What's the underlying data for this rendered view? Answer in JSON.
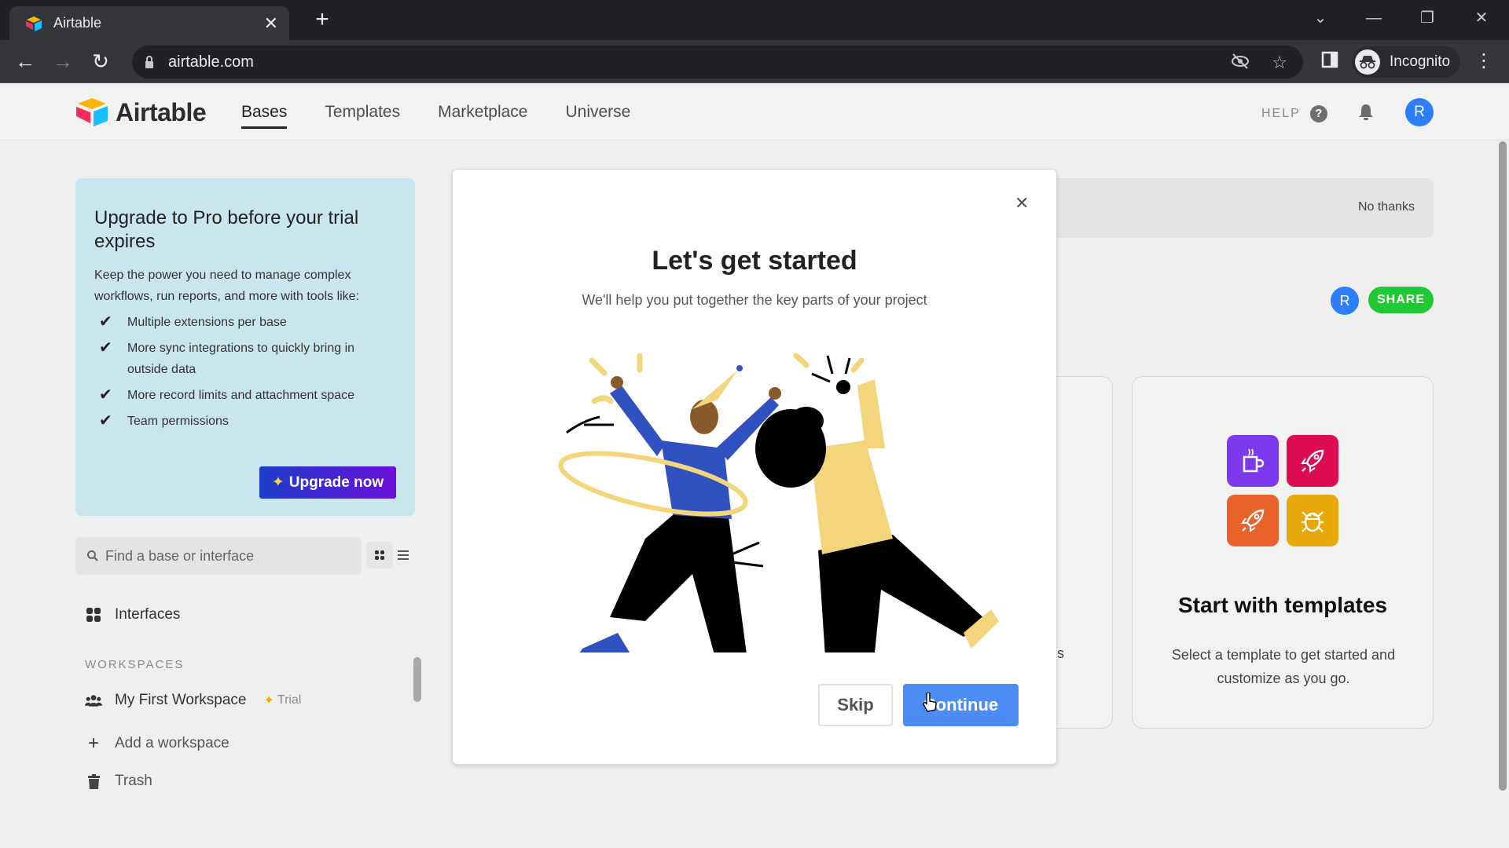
{
  "browser": {
    "tab_title": "Airtable",
    "url": "airtable.com",
    "profile_label": "Incognito",
    "icons": [
      "back-icon",
      "forward-icon",
      "reload-icon",
      "lock-icon",
      "eye-off-icon",
      "star-icon",
      "sidepanel-icon",
      "incognito-icon",
      "kebab-menu-icon",
      "tab-search-icon",
      "minimize-icon",
      "restore-icon",
      "close-icon"
    ]
  },
  "header": {
    "brand": "Airtable",
    "nav": [
      {
        "label": "Bases",
        "active": true
      },
      {
        "label": "Templates",
        "active": false
      },
      {
        "label": "Marketplace",
        "active": false
      },
      {
        "label": "Universe",
        "active": false
      }
    ],
    "help_label": "HELP",
    "help_icon": "?",
    "avatar_initial": "R"
  },
  "sidebar": {
    "upgrade": {
      "title": "Upgrade to Pro before your trial expires",
      "description": "Keep the power you need to manage complex workflows, run reports, and more with tools like:",
      "features": [
        "Multiple extensions per base",
        "More sync integrations to quickly bring in outside data",
        "More record limits and attachment space",
        "Team permissions"
      ],
      "button_label": "Upgrade now"
    },
    "search_placeholder": "Find a base or interface",
    "interfaces_label": "Interfaces",
    "workspaces_heading": "WORKSPACES",
    "workspace_name": "My First Workspace",
    "workspace_badge": "Trial",
    "add_workspace_label": "Add a workspace",
    "trash_label": "Trash"
  },
  "main": {
    "banner_dismiss": "No thanks",
    "share_avatar_initial": "R",
    "share_label": "SHARE",
    "partial_card_text": "ects",
    "templates_card": {
      "title": "Start with templates",
      "description": "Select a template to get started and customize as you go.",
      "tiles": [
        {
          "icon": "coffee-icon",
          "color": "#7c39ed"
        },
        {
          "icon": "rocket-icon",
          "color": "#dc0b53"
        },
        {
          "icon": "rocket-icon",
          "color": "#e8622b"
        },
        {
          "icon": "bug-icon",
          "color": "#e7a90a"
        }
      ]
    }
  },
  "modal": {
    "title": "Let's get started",
    "subtitle": "We'll help you put together the key parts of your project",
    "skip_label": "Skip",
    "continue_label": "Continue"
  },
  "colors": {
    "primary_blue": "#2d7ff9",
    "continue_blue": "#4b8cf5",
    "share_green": "#20c933",
    "upgrade_panel": "#c9e5ee"
  }
}
